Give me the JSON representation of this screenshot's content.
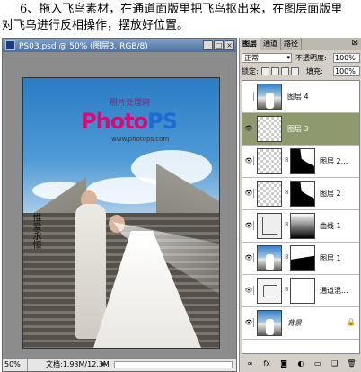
{
  "caption": {
    "line1": "6、拖入飞鸟素材，在通道面版里把飞鸟抠出来，在图层面版里",
    "line2": "对飞鸟进行反相操作，摆放好位置。"
  },
  "document": {
    "title": "PS03.psd @ 50% (图层3, RGB/8)",
    "photo_watermark": "照片处理网",
    "logo_part1": "Photo",
    "logo_part2": "PS",
    "logo_url": "www.photops.com",
    "calligraphy": "惟爱永恒",
    "zoom": "50%",
    "doc_info": "文档:1.93M/12.3M"
  },
  "layers_panel": {
    "tabs": [
      "图层",
      "通道",
      "路径"
    ],
    "blend_mode": "正常",
    "opacity_label": "不透明度:",
    "opacity_value": "100%",
    "lock_label": "锁定:",
    "fill_label": "填充:",
    "fill_value": "100%",
    "layers": [
      {
        "name": "图层 4",
        "visible": false,
        "thumb": "photo",
        "mask": false,
        "selected": false
      },
      {
        "name": "图层 3",
        "visible": true,
        "thumb": "checker",
        "mask": false,
        "selected": true
      },
      {
        "name": "图层 2...",
        "visible": true,
        "thumb": "checker",
        "mask": true,
        "selected": false
      },
      {
        "name": "图层 2",
        "visible": true,
        "thumb": "checker",
        "mask": true,
        "selected": false
      },
      {
        "name": "曲线 1",
        "visible": true,
        "thumb": "curves",
        "mask": true,
        "selected": false
      },
      {
        "name": "图层 1",
        "visible": true,
        "thumb": "photo",
        "mask": true,
        "selected": false
      },
      {
        "name": "通道混...",
        "visible": true,
        "thumb": "channel-mixer",
        "mask": true,
        "selected": false
      },
      {
        "name": "背景",
        "visible": true,
        "thumb": "photo",
        "mask": false,
        "selected": false
      }
    ],
    "bottom_icons": [
      "link-icon",
      "fx-icon",
      "mask-icon",
      "adjustment-icon",
      "folder-icon",
      "new-layer-icon",
      "trash-icon"
    ]
  },
  "colors": {
    "selected_layer": "#8e9a6e",
    "title_bar": "#4c6f9e"
  }
}
